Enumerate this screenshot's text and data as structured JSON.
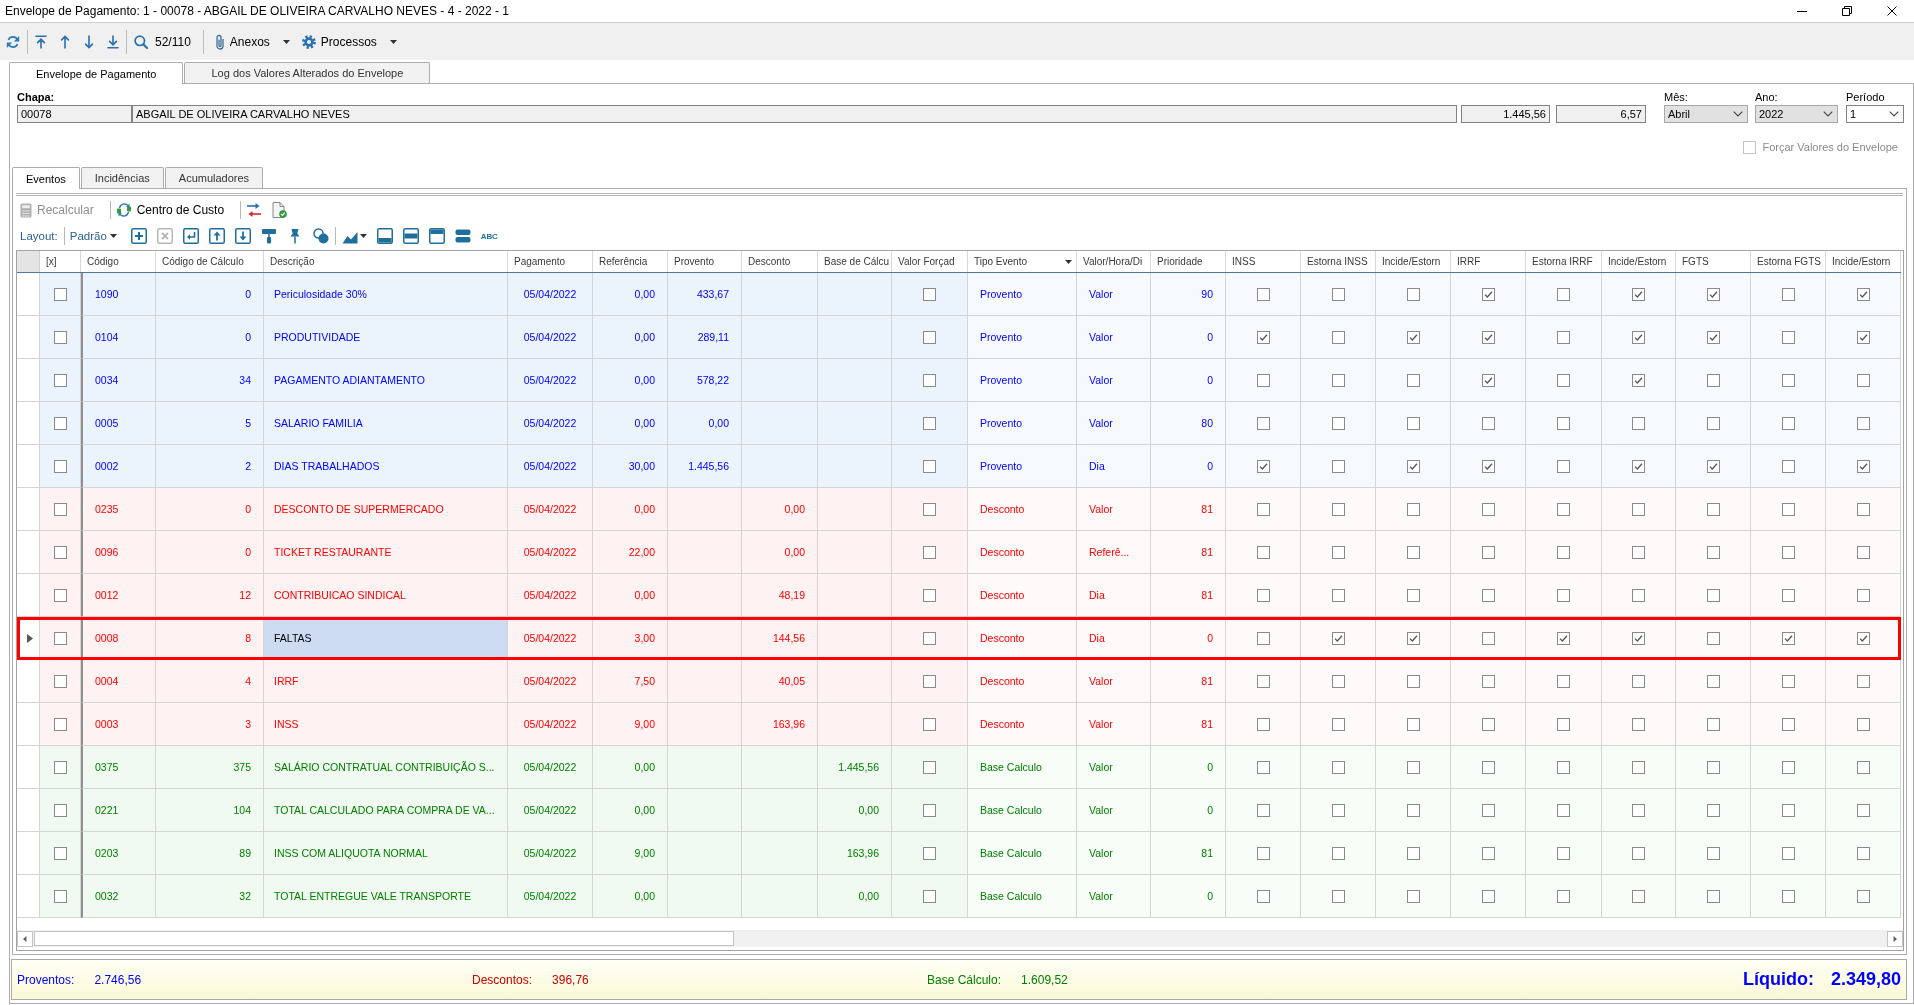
{
  "window": {
    "title": "Envelope de Pagamento: 1 - 00078 - ABGAIL DE OLIVEIRA CARVALHO NEVES - 4 - 2022 - 1"
  },
  "toolbar": {
    "record_counter": "52/110",
    "menus": [
      {
        "label": "Anexos",
        "kind": "attach"
      },
      {
        "label": "Processos",
        "kind": "process"
      }
    ]
  },
  "tabs": [
    {
      "label": "Envelope de Pagamento",
      "selected": true
    },
    {
      "label": "Log dos Valores Alterados do Envelope",
      "selected": false
    }
  ],
  "header_form": {
    "chapa_label": "Chapa:",
    "fields": [
      {
        "value": "00078",
        "kind": "text",
        "readonly": true
      },
      {
        "value": "ABGAIL DE OLIVEIRA CARVALHO NEVES",
        "kind": "text",
        "readonly": true
      },
      {
        "value": "1.445,56",
        "kind": "amount",
        "readonly": true
      },
      {
        "value": "6,57",
        "kind": "amount",
        "readonly": true
      }
    ],
    "selects": [
      {
        "label": "Mês:",
        "value": "Abril",
        "disabled": true
      },
      {
        "label": "Ano:",
        "value": "2022",
        "disabled": true
      },
      {
        "label": "Período",
        "value": "1",
        "disabled": false
      }
    ],
    "force_values": {
      "label": "Forçar Valores do Envelope",
      "checked": false,
      "disabled": true
    }
  },
  "subtabs": [
    {
      "label": "Eventos",
      "selected": true
    },
    {
      "label": "Incidências",
      "selected": false
    },
    {
      "label": "Acumuladores",
      "selected": false
    }
  ],
  "actions": [
    {
      "label": "Recalcular",
      "kind": "recalc",
      "disabled": true
    },
    {
      "label": "Centro de Custo",
      "kind": "cost",
      "disabled": false
    }
  ],
  "layout_bar": {
    "label": "Layout:",
    "preset": "Padrão",
    "buttons": [
      {
        "kind": "add",
        "disabled": false
      },
      {
        "kind": "remove",
        "disabled": true
      },
      {
        "kind": "enter",
        "disabled": false
      },
      {
        "kind": "raise",
        "disabled": false
      },
      {
        "kind": "lower",
        "disabled": false
      },
      {
        "kind": "paint",
        "disabled": false
      },
      {
        "kind": "pin",
        "disabled": false
      },
      {
        "kind": "shapes",
        "disabled": false
      },
      {
        "kind": "chart",
        "disabled": false
      },
      {
        "kind": "footer",
        "disabled": false
      },
      {
        "kind": "split",
        "disabled": false
      },
      {
        "kind": "header",
        "disabled": false
      },
      {
        "kind": "stack",
        "disabled": false
      },
      {
        "kind": "spell",
        "label": "ABC",
        "disabled": false
      }
    ]
  },
  "table": {
    "columns": [
      {
        "label": "[x]",
        "kind": "check",
        "filter": false,
        "focused": false
      },
      {
        "label": "Código",
        "kind": "text",
        "filter": false,
        "focused": false
      },
      {
        "label": "Código de Cálculo",
        "kind": "number",
        "filter": false,
        "focused": false
      },
      {
        "label": "Descrição",
        "kind": "text",
        "filter": false,
        "focused": true
      },
      {
        "label": "Pagamento",
        "kind": "date",
        "filter": false,
        "focused": false
      },
      {
        "label": "Referência",
        "kind": "number",
        "filter": false,
        "focused": false
      },
      {
        "label": "Provento",
        "kind": "number",
        "filter": false,
        "focused": false
      },
      {
        "label": "Desconto",
        "kind": "number",
        "filter": false,
        "focused": false
      },
      {
        "label": "Base de Cálcu",
        "kind": "number",
        "filter": false,
        "focused": false
      },
      {
        "label": "Valor Forçad",
        "kind": "check",
        "filter": false,
        "focused": false
      },
      {
        "label": "Tipo Evento",
        "kind": "text",
        "filter": true,
        "focused": false
      },
      {
        "label": "Valor/Hora/Di",
        "kind": "text",
        "filter": false,
        "focused": false
      },
      {
        "label": "Prioridade",
        "kind": "number",
        "filter": false,
        "focused": false
      },
      {
        "label": "INSS",
        "kind": "check",
        "filter": false,
        "focused": false
      },
      {
        "label": "Estorna INSS",
        "kind": "check",
        "filter": false,
        "focused": false
      },
      {
        "label": "Incide/Estorn",
        "kind": "check",
        "filter": false,
        "focused": false
      },
      {
        "label": "IRRF",
        "kind": "check",
        "filter": false,
        "focused": false
      },
      {
        "label": "Estorna IRRF",
        "kind": "check",
        "filter": false,
        "focused": false
      },
      {
        "label": "Incide/Estorn",
        "kind": "check",
        "filter": false,
        "focused": false
      },
      {
        "label": "FGTS",
        "kind": "check",
        "filter": false,
        "focused": false
      },
      {
        "label": "Estorna FGTS",
        "kind": "check",
        "filter": false,
        "focused": false
      },
      {
        "label": "Incide/Estorn",
        "kind": "check",
        "filter": false,
        "focused": false
      }
    ],
    "rows": [
      {
        "kind": "provento",
        "selected": false,
        "cells": [
          false,
          "1090",
          "0",
          "Periculosidade 30%",
          "05/04/2022",
          "0,00",
          "433,67",
          null,
          null,
          false,
          "Provento",
          "Valor",
          "90",
          false,
          false,
          false,
          true,
          false,
          true,
          true,
          false,
          true
        ]
      },
      {
        "kind": "provento",
        "selected": false,
        "cells": [
          false,
          "0104",
          "0",
          "PRODUTIVIDADE",
          "05/04/2022",
          "0,00",
          "289,11",
          null,
          null,
          false,
          "Provento",
          "Valor",
          "0",
          true,
          false,
          true,
          true,
          false,
          true,
          true,
          false,
          true
        ]
      },
      {
        "kind": "provento",
        "selected": false,
        "cells": [
          false,
          "0034",
          "34",
          "PAGAMENTO ADIANTAMENTO",
          "05/04/2022",
          "0,00",
          "578,22",
          null,
          null,
          false,
          "Provento",
          "Valor",
          "0",
          false,
          false,
          false,
          true,
          false,
          true,
          false,
          false,
          false
        ]
      },
      {
        "kind": "provento",
        "selected": false,
        "cells": [
          false,
          "0005",
          "5",
          "SALARIO FAMILIA",
          "05/04/2022",
          "0,00",
          "0,00",
          null,
          null,
          false,
          "Provento",
          "Valor",
          "80",
          false,
          false,
          false,
          false,
          false,
          false,
          false,
          false,
          false
        ]
      },
      {
        "kind": "provento",
        "selected": false,
        "cells": [
          false,
          "0002",
          "2",
          "DIAS TRABALHADOS",
          "05/04/2022",
          "30,00",
          "1.445,56",
          null,
          null,
          false,
          "Provento",
          "Dia",
          "0",
          true,
          false,
          true,
          true,
          false,
          true,
          true,
          false,
          true
        ]
      },
      {
        "kind": "desconto",
        "selected": false,
        "cells": [
          false,
          "0235",
          "0",
          "DESCONTO DE SUPERMERCADO",
          "05/04/2022",
          "0,00",
          null,
          "0,00",
          null,
          false,
          "Desconto",
          "Valor",
          "81",
          false,
          false,
          false,
          false,
          false,
          false,
          false,
          false,
          false
        ]
      },
      {
        "kind": "desconto",
        "selected": false,
        "cells": [
          false,
          "0096",
          "0",
          "TICKET RESTAURANTE",
          "05/04/2022",
          "22,00",
          null,
          "0,00",
          null,
          false,
          "Desconto",
          "Referê...",
          "81",
          false,
          false,
          false,
          false,
          false,
          false,
          false,
          false,
          false
        ]
      },
      {
        "kind": "desconto",
        "selected": false,
        "cells": [
          false,
          "0012",
          "12",
          "CONTRIBUICAO SINDICAL",
          "05/04/2022",
          "0,00",
          null,
          "48,19",
          null,
          false,
          "Desconto",
          "Dia",
          "81",
          false,
          false,
          false,
          false,
          false,
          false,
          false,
          false,
          false
        ]
      },
      {
        "kind": "desconto",
        "selected": true,
        "cells": [
          false,
          "0008",
          "8",
          "FALTAS",
          "05/04/2022",
          "3,00",
          null,
          "144,56",
          null,
          false,
          "Desconto",
          "Dia",
          "0",
          false,
          true,
          true,
          false,
          true,
          true,
          false,
          true,
          true
        ]
      },
      {
        "kind": "desconto",
        "selected": false,
        "cells": [
          false,
          "0004",
          "4",
          "IRRF",
          "05/04/2022",
          "7,50",
          null,
          "40,05",
          null,
          false,
          "Desconto",
          "Valor",
          "81",
          false,
          false,
          false,
          false,
          false,
          false,
          false,
          false,
          false
        ]
      },
      {
        "kind": "desconto",
        "selected": false,
        "cells": [
          false,
          "0003",
          "3",
          "INSS",
          "05/04/2022",
          "9,00",
          null,
          "163,96",
          null,
          false,
          "Desconto",
          "Valor",
          "81",
          false,
          false,
          false,
          false,
          false,
          false,
          false,
          false,
          false
        ]
      },
      {
        "kind": "base",
        "selected": false,
        "cells": [
          false,
          "0375",
          "375",
          "SALÁRIO CONTRATUAL CONTRIBUIÇÃO S...",
          "05/04/2022",
          "0,00",
          null,
          null,
          "1.445,56",
          false,
          "Base Calculo",
          "Valor",
          "0",
          false,
          false,
          false,
          false,
          false,
          false,
          false,
          false,
          false
        ]
      },
      {
        "kind": "base",
        "selected": false,
        "cells": [
          false,
          "0221",
          "104",
          "TOTAL CALCULADO PARA COMPRA DE VA...",
          "05/04/2022",
          "0,00",
          null,
          null,
          "0,00",
          false,
          "Base Calculo",
          "Valor",
          "0",
          false,
          false,
          false,
          false,
          false,
          false,
          false,
          false,
          false
        ]
      },
      {
        "kind": "base",
        "selected": false,
        "cells": [
          false,
          "0203",
          "89",
          "INSS COM ALIQUOTA NORMAL",
          "05/04/2022",
          "9,00",
          null,
          null,
          "163,96",
          false,
          "Base Calculo",
          "Valor",
          "81",
          false,
          false,
          false,
          false,
          false,
          false,
          false,
          false,
          false
        ]
      },
      {
        "kind": "base",
        "selected": false,
        "cells": [
          false,
          "0032",
          "32",
          "TOTAL ENTREGUE VALE TRANSPORTE",
          "05/04/2022",
          "0,00",
          null,
          null,
          "0,00",
          false,
          "Base Calculo",
          "Valor",
          "0",
          false,
          false,
          false,
          false,
          false,
          false,
          false,
          false,
          false
        ]
      }
    ]
  },
  "totals": [
    {
      "label": "Proventos:",
      "value": "2.746,56",
      "kind": "sum",
      "color": "#0000ff"
    },
    {
      "label": "Descontos:",
      "value": "396,76",
      "kind": "sum",
      "color": "#cc0000"
    },
    {
      "label": "Base Cálculo:",
      "value": "1.609,52",
      "kind": "sum",
      "color": "#008000"
    },
    {
      "label": "Líquido:",
      "value": "2.349,80",
      "kind": "net",
      "color": "#0000ff"
    }
  ]
}
